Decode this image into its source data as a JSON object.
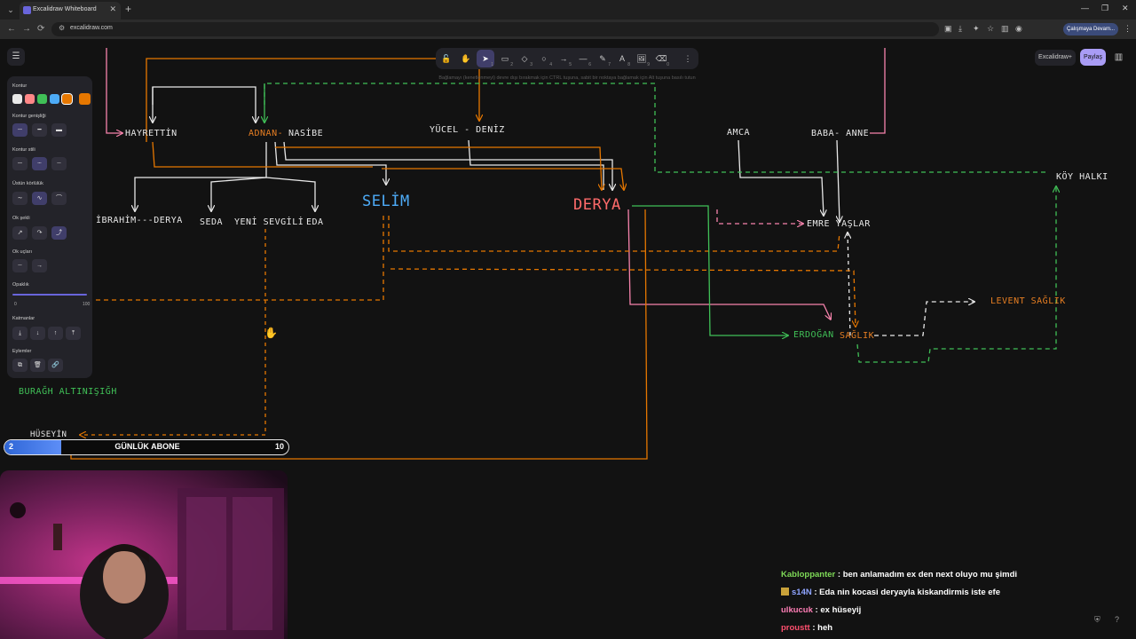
{
  "browser": {
    "tab_title": "Excalidraw Whiteboard",
    "url": "excalidraw.com",
    "profile_label": "Çalışmaya Devam..."
  },
  "toolbar": {
    "tools": [
      {
        "name": "lock",
        "icon": "🔓",
        "num": ""
      },
      {
        "name": "hand",
        "icon": "✋",
        "num": ""
      },
      {
        "name": "selection",
        "icon": "➤",
        "num": "1",
        "active": true
      },
      {
        "name": "rectangle",
        "icon": "▭",
        "num": "2"
      },
      {
        "name": "diamond",
        "icon": "◇",
        "num": "3"
      },
      {
        "name": "ellipse",
        "icon": "○",
        "num": "4"
      },
      {
        "name": "arrow",
        "icon": "→",
        "num": "5"
      },
      {
        "name": "line",
        "icon": "—",
        "num": "6"
      },
      {
        "name": "pencil",
        "icon": "✎",
        "num": "7"
      },
      {
        "name": "text",
        "icon": "A",
        "num": "8"
      },
      {
        "name": "image",
        "icon": "🖼",
        "num": "9"
      },
      {
        "name": "eraser",
        "icon": "⌫",
        "num": "0"
      },
      {
        "name": "more",
        "icon": "⋮",
        "num": ""
      }
    ],
    "hint": "Bağlamayı (kenetlenmeyi) devre dışı bırakmak için CTRL tuşuna, sabit bir noktaya bağlamak için Alt tuşuna basılı tutun"
  },
  "top_right": {
    "excalidraw_plus": "Excalidraw+",
    "share": "Paylaş"
  },
  "panel": {
    "stroke_label": "Kontur",
    "stroke_width_label": "Kontur genişliği",
    "stroke_style_label": "Kontur stili",
    "sloppiness_label": "Üstün körlülük",
    "arrow_type_label": "Ok şekli",
    "arrowheads_label": "Ok uçları",
    "opacity_label": "Opaklık",
    "opacity_min": "0",
    "opacity_max": "100",
    "opacity_value": 100,
    "layers_label": "Katmanlar",
    "actions_label": "Eylemler",
    "colors": [
      "#e8e8e8",
      "#ff8787",
      "#40c057",
      "#4dabf7",
      "#e67700"
    ],
    "current_color": "#e67700"
  },
  "diagram": {
    "nodes": {
      "hayrettin": "HAYRETTİN",
      "adnan": "ADNAN-",
      "nasibe": "NASİBE",
      "yucel_deniz": "YÜCEL - DENİZ",
      "amca": "AMCA",
      "baba_anne": "BABA- ANNE",
      "koy_halki": "KÖY HALKI",
      "ibrahim_derya": "İBRAHİM---DERYA",
      "seda": "SEDA",
      "yeni_sevgili": "YENİ SEVGİLİ",
      "eda": "EDA",
      "selim": "SELİM",
      "derya": "DERYA",
      "emre_yaslar": "EMRE YAŞLAR",
      "levent_saglik": "LEVENT SAĞLIK",
      "erdogan": "ERDOĞAN",
      "saglik": "SAĞLIK",
      "buragh": "BURAĞH ALTINIŞIĞH",
      "huseyin": "HÜSEYİN"
    }
  },
  "sub_goal": {
    "title": "GÜNLÜK ABONE",
    "current": "2",
    "goal": "10",
    "progress": 0.2
  },
  "chat": [
    {
      "user": "Kabloppanter",
      "color": "#7ed957",
      "message": "ben anlamadım ex den next oluyo mu şimdi",
      "badge": false
    },
    {
      "user": "s14N",
      "color": "#8fa4ff",
      "message": "Eda nin kocasi deryayla kiskandirmis iste efe",
      "badge": true
    },
    {
      "user": "ulkucuk",
      "color": "#ff7eb6",
      "message": "ex hüseyij",
      "badge": false
    },
    {
      "user": "proustt",
      "color": "#ff4f6e",
      "message": "heh",
      "badge": false
    }
  ]
}
